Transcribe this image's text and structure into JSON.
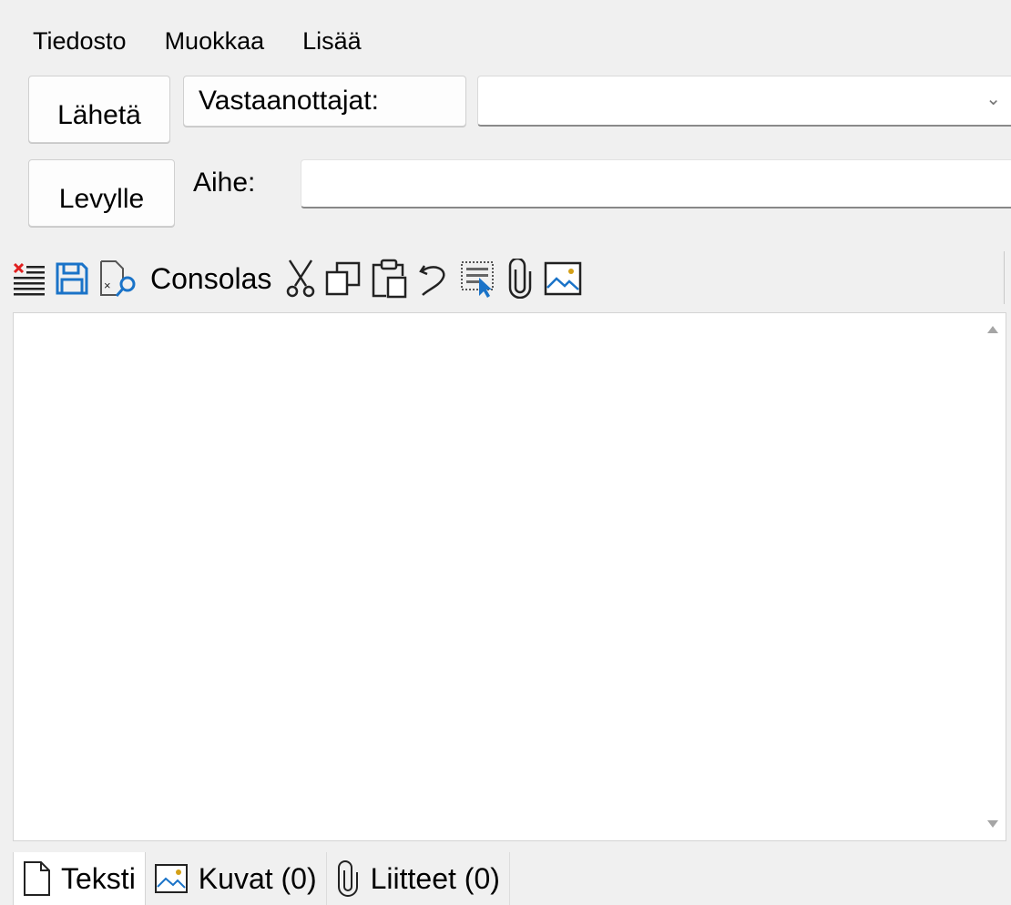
{
  "menu": {
    "items": [
      "Tiedosto",
      "Muokkaa",
      "Lisää"
    ]
  },
  "header": {
    "send_label": "Lähetä",
    "to_disk_label": "Levylle",
    "recipients_label": "Vastaanottajat:",
    "recipients_value": "",
    "subject_label": "Aihe:",
    "subject_value": ""
  },
  "toolbar": {
    "font_name": "Consolas",
    "icons": [
      "clear-text-icon",
      "save-icon",
      "preview-icon",
      "cut-icon",
      "copy-icon",
      "paste-icon",
      "undo-icon",
      "select-all-icon",
      "attach-icon",
      "insert-image-icon"
    ]
  },
  "editor": {
    "content": ""
  },
  "tabs": [
    {
      "label": "Teksti",
      "icon": "document-icon",
      "active": true
    },
    {
      "label": "Kuvat (0)",
      "icon": "image-icon",
      "active": false
    },
    {
      "label": "Liitteet (0)",
      "icon": "paperclip-icon",
      "active": false
    }
  ],
  "colors": {
    "accent": "#1a73c8",
    "delete_red": "#e02020",
    "background": "#f0f0f0"
  }
}
